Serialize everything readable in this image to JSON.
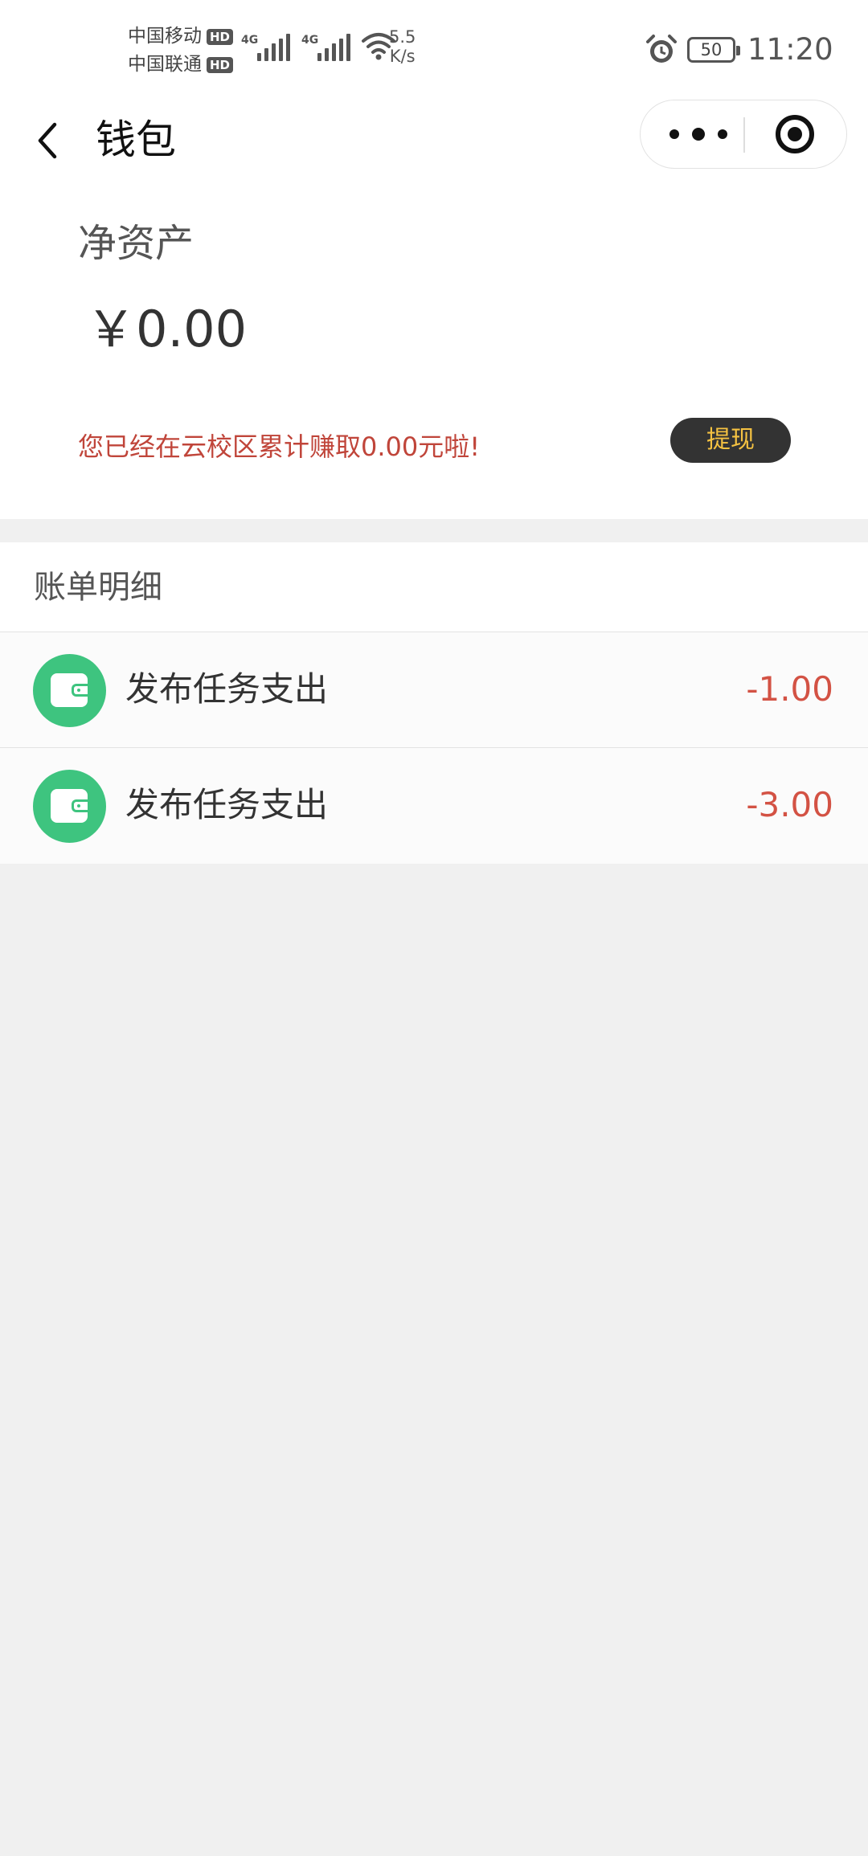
{
  "status_bar": {
    "carrier_1": "中国移动",
    "carrier_2": "中国联通",
    "hd_badge": "HD",
    "network_type": "4G",
    "net_speed_value": "5.5",
    "net_speed_unit": "K/s",
    "battery_level": "50",
    "time": "11:20"
  },
  "nav": {
    "title": "钱包"
  },
  "asset": {
    "label": "净资产",
    "value": "￥0.00",
    "earn_tip": "您已经在云校区累计赚取0.00元啦!",
    "withdraw_label": "提现"
  },
  "bill": {
    "header": "账单明细",
    "items": [
      {
        "title": "发布任务支出",
        "amount": "-1.00",
        "icon": "wallet-icon"
      },
      {
        "title": "发布任务支出",
        "amount": "-3.00",
        "icon": "wallet-icon"
      }
    ]
  },
  "colors": {
    "accent_green": "#3ec47f",
    "amount_red": "#d35244",
    "tip_red": "#c0453a",
    "withdraw_bg": "#333333",
    "withdraw_text": "#f5c242"
  }
}
